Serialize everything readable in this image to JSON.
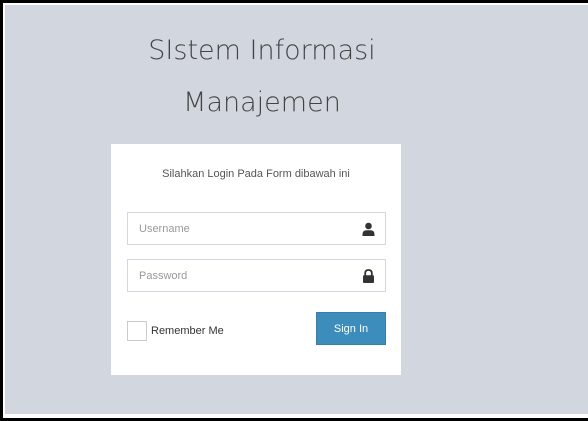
{
  "header": {
    "title_line1": "SIstem Informasi",
    "title_line2": "Manajemen"
  },
  "login": {
    "message": "Silahkan Login Pada Form dibawah ini",
    "username_placeholder": "Username",
    "username_value": "",
    "password_placeholder": "Password",
    "password_value": "",
    "remember_label": "Remember Me",
    "remember_checked": false,
    "signin_label": "Sign In"
  },
  "icons": {
    "username": "user-icon",
    "password": "lock-icon"
  },
  "colors": {
    "background": "#d2d6de",
    "panel": "#ffffff",
    "button": "#3c8dbc",
    "icon": "#333333"
  }
}
